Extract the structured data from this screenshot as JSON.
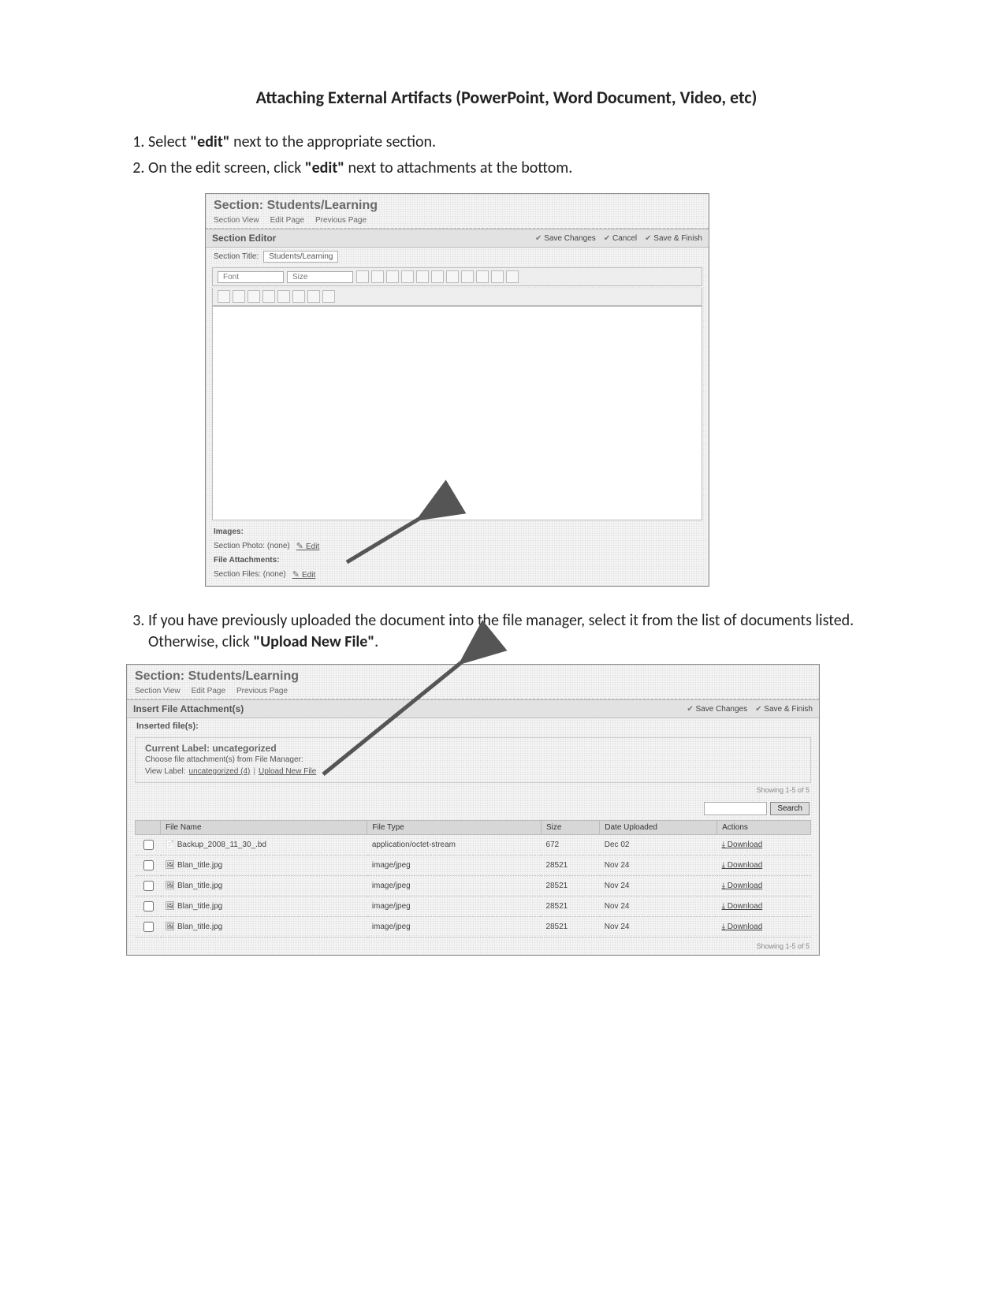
{
  "title": "Attaching External Artifacts (PowerPoint, Word Document, Video, etc)",
  "steps": {
    "s1a": "Select ",
    "s1b": "\"edit\"",
    "s1c": " next to the appropriate section.",
    "s2a": "On the edit screen, click ",
    "s2b": "\"edit\"",
    "s2c": " next to attachments at the bottom.",
    "s3a": "If you have previously uploaded the document into the file manager, select it from the list of documents listed. Otherwise, click ",
    "s3b": "\"Upload New File\"",
    "s3c": "."
  },
  "shot1": {
    "section_title": "Section: Students/Learning",
    "tabs": [
      "Section View",
      "Edit Page",
      "Previous Page"
    ],
    "panel": "Section Editor",
    "rbtns": [
      "Save Changes",
      "Cancel",
      "Save & Finish"
    ],
    "field_label": "Section Title:",
    "field_value": "Students/Learning",
    "tb_font": "Font",
    "tb_size": "Size",
    "images_label": "Images:",
    "images_row": "Section Photo:   (none)",
    "images_edit": "Edit",
    "attach_label": "File Attachments:",
    "attach_row": "Section Files:   (none)",
    "attach_edit": "Edit"
  },
  "shot2": {
    "section_title": "Section: Students/Learning",
    "tabs": [
      "Section View",
      "Edit Page",
      "Previous Page"
    ],
    "panel": "Insert File Attachment(s)",
    "rbtns": [
      "Save Changes",
      "Save & Finish"
    ],
    "inserted": "Inserted file(s):",
    "current_label": "Current Label:  uncategorized",
    "chooser": "Choose file attachment(s) from File Manager:",
    "view_label": "View Label:",
    "view_link1": "uncategorized (4)",
    "view_link2": "Upload New File",
    "showing_top": "Showing 1-5 of 5",
    "search_btn": "Search",
    "cols": [
      "",
      "File Name",
      "File Type",
      "Size",
      "Date Uploaded",
      "Actions"
    ],
    "rows": [
      {
        "icon": "doc",
        "name": "Backup_2008_11_30_.bd",
        "type": "application/octet-stream",
        "size": "672",
        "date": "Dec 02",
        "action": "Download"
      },
      {
        "icon": "img",
        "name": "Blan_title.jpg",
        "type": "image/jpeg",
        "size": "28521",
        "date": "Nov 24",
        "action": "Download"
      },
      {
        "icon": "img",
        "name": "Blan_title.jpg",
        "type": "image/jpeg",
        "size": "28521",
        "date": "Nov 24",
        "action": "Download"
      },
      {
        "icon": "img",
        "name": "Blan_title.jpg",
        "type": "image/jpeg",
        "size": "28521",
        "date": "Nov 24",
        "action": "Download"
      },
      {
        "icon": "img",
        "name": "Blan_title.jpg",
        "type": "image/jpeg",
        "size": "28521",
        "date": "Nov 24",
        "action": "Download"
      }
    ],
    "showing_bottom": "Showing 1-5 of 5"
  }
}
